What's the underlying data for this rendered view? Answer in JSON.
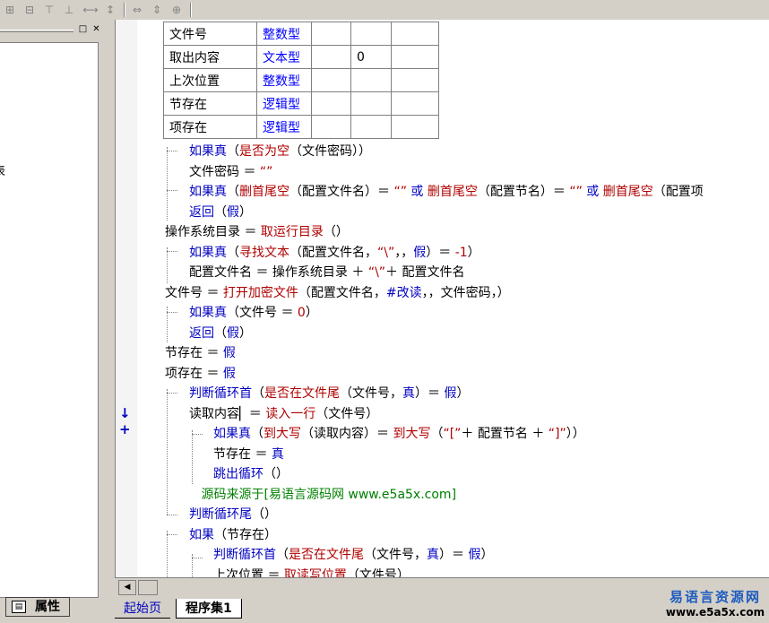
{
  "toolbar": {
    "icons": [
      "align-left-icon",
      "align-center-icon",
      "align-top-icon",
      "align-middle-icon",
      "hspace-icon",
      "vspace-icon",
      "same-width-icon",
      "same-height-icon",
      "same-size-icon"
    ]
  },
  "left_panel": {
    "clipped_text": "表",
    "minimize_glyph": "□",
    "close_glyph": "✕",
    "properties_tab_label": "属性"
  },
  "var_table": [
    [
      "文件号",
      "整数型",
      "",
      "",
      ""
    ],
    [
      "取出内容",
      "文本型",
      "",
      "0",
      ""
    ],
    [
      "上次位置",
      "整数型",
      "",
      "",
      ""
    ],
    [
      "节存在",
      "逻辑型",
      "",
      "",
      ""
    ],
    [
      "项存在",
      "逻辑型",
      "",
      "",
      ""
    ]
  ],
  "gutter": {
    "marks": "↓ +"
  },
  "code_lines": [
    {
      "indent": 1,
      "parts": [
        [
          "kw",
          "如果真"
        ],
        [
          "",
          "（"
        ],
        [
          "fn",
          "是否为空"
        ],
        [
          "",
          "（文件密码））"
        ]
      ]
    },
    {
      "indent": 1,
      "parts": [
        [
          "",
          "文件密码 ＝ "
        ],
        [
          "fn",
          "“”"
        ]
      ]
    },
    {
      "indent": 1,
      "parts": [
        [
          "kw",
          "如果真"
        ],
        [
          "",
          "（"
        ],
        [
          "fn",
          "删首尾空"
        ],
        [
          "",
          "（配置文件名）＝ "
        ],
        [
          "fn",
          "“”"
        ],
        [
          "kw",
          " 或 "
        ],
        [
          "fn",
          "删首尾空"
        ],
        [
          "",
          "（配置节名）＝ "
        ],
        [
          "fn",
          "“”"
        ],
        [
          "kw",
          " 或 "
        ],
        [
          "fn",
          "删首尾空"
        ],
        [
          "",
          "（配置项"
        ]
      ]
    },
    {
      "indent": 1,
      "parts": [
        [
          "kw",
          "返回"
        ],
        [
          "",
          "（"
        ],
        [
          "kw",
          "假"
        ],
        [
          "",
          "）"
        ]
      ]
    },
    {
      "indent": 0,
      "parts": [
        [
          "",
          "操作系统目录 ＝ "
        ],
        [
          "fn",
          "取运行目录"
        ],
        [
          "",
          "（）"
        ]
      ]
    },
    {
      "indent": 1,
      "parts": [
        [
          "kw",
          "如果真"
        ],
        [
          "",
          "（"
        ],
        [
          "fn",
          "寻找文本"
        ],
        [
          "",
          "（配置文件名，"
        ],
        [
          "fn",
          "“\\”"
        ],
        [
          "",
          "，，"
        ],
        [
          "kw",
          "假"
        ],
        [
          "",
          "）＝ "
        ],
        [
          "fn",
          "-1"
        ],
        [
          "",
          "）"
        ]
      ]
    },
    {
      "indent": 1,
      "parts": [
        [
          "",
          "配置文件名 ＝ 操作系统目录 ＋ "
        ],
        [
          "fn",
          "“\\”"
        ],
        [
          "",
          ""
        ],
        [
          "",
          "＋ 配置文件名"
        ]
      ]
    },
    {
      "indent": 0,
      "parts": [
        [
          "",
          "文件号 ＝ "
        ],
        [
          "fn",
          "打开加密文件"
        ],
        [
          "",
          "（配置文件名，"
        ],
        [
          "kw",
          "#改读"
        ],
        [
          "",
          "，，文件密码，）"
        ]
      ]
    },
    {
      "indent": 1,
      "parts": [
        [
          "kw",
          "如果真"
        ],
        [
          "",
          "（文件号 ＝ "
        ],
        [
          "fn",
          "0"
        ],
        [
          "",
          "）"
        ]
      ]
    },
    {
      "indent": 1,
      "parts": [
        [
          "kw",
          "返回"
        ],
        [
          "",
          "（"
        ],
        [
          "kw",
          "假"
        ],
        [
          "",
          "）"
        ]
      ]
    },
    {
      "indent": 0,
      "parts": [
        [
          "",
          "节存在 ＝ "
        ],
        [
          "kw",
          "假"
        ]
      ]
    },
    {
      "indent": 0,
      "parts": [
        [
          "",
          "项存在 ＝ "
        ],
        [
          "kw",
          "假"
        ]
      ]
    },
    {
      "indent": 1,
      "parts": [
        [
          "kw",
          "判断循环首"
        ],
        [
          "",
          "（"
        ],
        [
          "fn",
          "是否在文件尾"
        ],
        [
          "",
          "（文件号，"
        ],
        [
          "kw",
          "真"
        ],
        [
          "",
          "）＝ "
        ],
        [
          "kw",
          "假"
        ],
        [
          "",
          "）"
        ]
      ]
    },
    {
      "indent": 1,
      "parts": [
        [
          "",
          "读取内容"
        ],
        [
          "",
          "▏＝ "
        ],
        [
          "fn",
          "读入一行"
        ],
        [
          "",
          "（文件号）"
        ]
      ]
    },
    {
      "indent": 2,
      "parts": [
        [
          "kw",
          "如果真"
        ],
        [
          "",
          "（"
        ],
        [
          "fn",
          "到大写"
        ],
        [
          "",
          "（读取内容）＝ "
        ],
        [
          "fn",
          "到大写"
        ],
        [
          "",
          "（"
        ],
        [
          "fn",
          "“[”"
        ],
        [
          "",
          ""
        ],
        [
          "",
          "＋ 配置节名 ＋ "
        ],
        [
          "fn",
          "“]”"
        ],
        [
          "",
          "））"
        ]
      ]
    },
    {
      "indent": 2,
      "parts": [
        [
          "",
          "节存在 ＝ "
        ],
        [
          "kw",
          "真"
        ]
      ]
    },
    {
      "indent": 2,
      "parts": [
        [
          "kw",
          "跳出循环"
        ],
        [
          "",
          "（）"
        ]
      ]
    },
    {
      "indent": 1.5,
      "parts": [
        [
          "cm",
          "源码来源于[易语言源码网 www.e5a5x.com]"
        ]
      ]
    },
    {
      "indent": 1,
      "parts": [
        [
          "kw",
          "判断循环尾"
        ],
        [
          "",
          "（）"
        ]
      ]
    },
    {
      "indent": 1,
      "parts": [
        [
          "kw",
          "如果"
        ],
        [
          "",
          "（节存在）"
        ]
      ]
    },
    {
      "indent": 2,
      "parts": [
        [
          "kw",
          "判断循环首"
        ],
        [
          "",
          "（"
        ],
        [
          "fn",
          "是否在文件尾"
        ],
        [
          "",
          "（文件号，"
        ],
        [
          "kw",
          "真"
        ],
        [
          "",
          "）＝ "
        ],
        [
          "kw",
          "假"
        ],
        [
          "",
          "）"
        ]
      ]
    },
    {
      "indent": 2,
      "parts": [
        [
          "",
          "上次位置 ＝ "
        ],
        [
          "fn",
          "取读写位置"
        ],
        [
          "",
          "（文件号）"
        ]
      ]
    }
  ],
  "tabs": {
    "start": "起始页",
    "program": "程序集1"
  },
  "watermark": {
    "line1": "易语言资源网",
    "line2": "www.e5a5x.com"
  }
}
